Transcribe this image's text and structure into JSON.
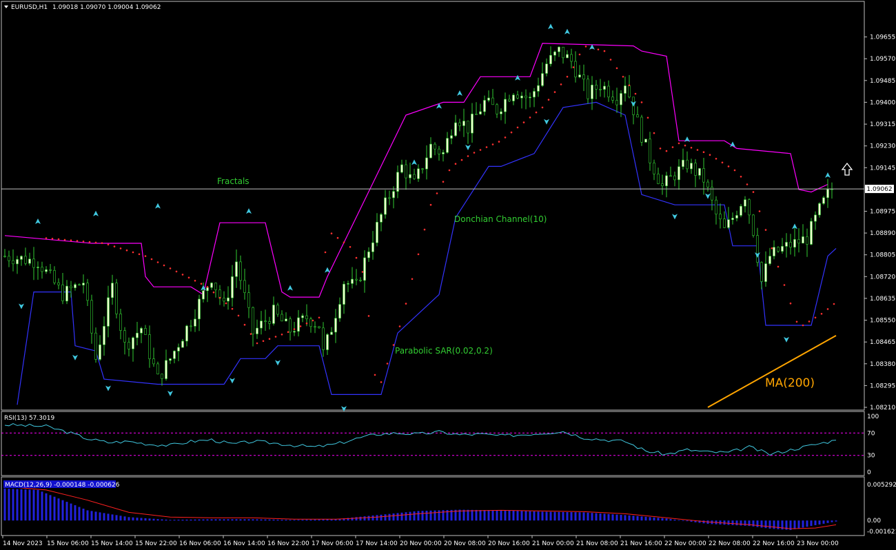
{
  "header": {
    "symbol": "EURUSD,H1",
    "ohlc": "1.09018 1.09070 1.09004 1.09062"
  },
  "colors": {
    "background": "#000000",
    "bull_candle": "#f0ffd0",
    "bear_candle": "#000000",
    "candle_wick": "#32cd32",
    "donchian_upper": "#ff00ff",
    "donchian_lower": "#3333ff",
    "sar": "#ff3030",
    "fractal": "#40c8e0",
    "ma200": "#ffa500",
    "rsi_line": "#40c8e0",
    "rsi_levels": "#ff00ff",
    "macd_hist": "#2222dd",
    "macd_signal": "#ff2020",
    "price_line": "#c0c0c0",
    "label_green": "#32cd32",
    "label_orange": "#ffa500",
    "axis_text": "#ffffff"
  },
  "annotations": {
    "fractals": "Fractals",
    "donchian": "Donchian Channel(10)",
    "sar": "Parabolic SAR(0.02,0.2)",
    "ma": "MA(200)"
  },
  "arrow_icon": "up-arrow-icon",
  "chart_data": {
    "type": "candlestick",
    "main": {
      "ylim": [
        1.0821,
        1.0974
      ],
      "yticks": [
        "1.09655",
        "1.09570",
        "1.09485",
        "1.09400",
        "1.09315",
        "1.09230",
        "1.09145",
        "1.09062",
        "1.08975",
        "1.08890",
        "1.08805",
        "1.08720",
        "1.08635",
        "1.08550",
        "1.08465",
        "1.08380",
        "1.08295",
        "1.08210"
      ],
      "current_price": "1.09062",
      "waypoints": [
        [
          0,
          1.088
        ],
        [
          8,
          1.0878
        ],
        [
          14,
          1.0865
        ],
        [
          19,
          1.087
        ],
        [
          22,
          1.084
        ],
        [
          26,
          1.0868
        ],
        [
          29,
          1.0845
        ],
        [
          33,
          1.0852
        ],
        [
          37,
          1.0832
        ],
        [
          40,
          1.084
        ],
        [
          45,
          1.0855
        ],
        [
          50,
          1.0872
        ],
        [
          53,
          1.086
        ],
        [
          56,
          1.0878
        ],
        [
          60,
          1.085
        ],
        [
          65,
          1.0858
        ],
        [
          69,
          1.0851
        ],
        [
          73,
          1.0856
        ],
        [
          76,
          1.0853
        ],
        [
          77,
          1.0842
        ],
        [
          79,
          1.0852
        ],
        [
          82,
          1.087
        ],
        [
          85,
          1.0868
        ],
        [
          88,
          1.0883
        ],
        [
          92,
          1.09
        ],
        [
          96,
          1.0915
        ],
        [
          99,
          1.0908
        ],
        [
          103,
          1.0923
        ],
        [
          106,
          1.092
        ],
        [
          109,
          1.0935
        ],
        [
          112,
          1.093
        ],
        [
          116,
          1.094
        ],
        [
          119,
          1.0937
        ],
        [
          123,
          1.0945
        ],
        [
          127,
          1.0941
        ],
        [
          131,
          1.0955
        ],
        [
          134,
          1.096
        ],
        [
          137,
          1.0956
        ],
        [
          141,
          1.0943
        ],
        [
          144,
          1.0947
        ],
        [
          148,
          1.0942
        ],
        [
          150,
          1.0948
        ],
        [
          153,
          1.0932
        ],
        [
          156,
          1.0918
        ],
        [
          159,
          1.0907
        ],
        [
          162,
          1.0912
        ],
        [
          165,
          1.0916
        ],
        [
          169,
          1.091
        ],
        [
          172,
          1.0896
        ],
        [
          174,
          1.089
        ],
        [
          176,
          1.0895
        ],
        [
          179,
          1.0904
        ],
        [
          181,
          1.089
        ],
        [
          183,
          1.087
        ],
        [
          185,
          1.088
        ],
        [
          188,
          1.0883
        ],
        [
          191,
          1.0885
        ],
        [
          194,
          1.0887
        ],
        [
          197,
          1.0898
        ],
        [
          199,
          1.0904
        ],
        [
          200,
          1.0906
        ]
      ],
      "donchian_upper": [
        [
          0,
          1.0888
        ],
        [
          21,
          1.0885
        ],
        [
          33,
          1.0885
        ],
        [
          34,
          1.0872
        ],
        [
          36,
          1.0868
        ],
        [
          45,
          1.0868
        ],
        [
          48,
          1.0865
        ],
        [
          52,
          1.0893
        ],
        [
          63,
          1.0893
        ],
        [
          67,
          1.0866
        ],
        [
          69,
          1.0864
        ],
        [
          76,
          1.0864
        ],
        [
          78,
          1.0872
        ],
        [
          97,
          1.0935
        ],
        [
          106,
          1.094
        ],
        [
          111,
          1.094
        ],
        [
          115,
          1.095
        ],
        [
          127,
          1.095
        ],
        [
          130,
          1.0963
        ],
        [
          152,
          1.0962
        ],
        [
          154,
          1.096
        ],
        [
          160,
          1.0958
        ],
        [
          163,
          1.0925
        ],
        [
          174,
          1.0925
        ],
        [
          177,
          1.0922
        ],
        [
          190,
          1.092
        ],
        [
          192,
          1.0906
        ],
        [
          195,
          1.0905
        ],
        [
          199,
          1.0908
        ]
      ],
      "donchian_lower": [
        [
          3,
          1.0822
        ],
        [
          7,
          1.0866
        ],
        [
          16,
          1.0866
        ],
        [
          17,
          1.0845
        ],
        [
          22,
          1.0843
        ],
        [
          24,
          1.0832
        ],
        [
          37,
          1.083
        ],
        [
          53,
          1.083
        ],
        [
          57,
          1.084
        ],
        [
          63,
          1.084
        ],
        [
          66,
          1.0845
        ],
        [
          76,
          1.0845
        ],
        [
          79,
          1.0826
        ],
        [
          91,
          1.0826
        ],
        [
          95,
          1.085
        ],
        [
          105,
          1.0865
        ],
        [
          109,
          1.0895
        ],
        [
          117,
          1.0915
        ],
        [
          120,
          1.0915
        ],
        [
          128,
          1.092
        ],
        [
          135,
          1.0938
        ],
        [
          143,
          1.094
        ],
        [
          150,
          1.0935
        ],
        [
          154,
          1.0904
        ],
        [
          162,
          1.09
        ],
        [
          174,
          1.09
        ],
        [
          176,
          1.0884
        ],
        [
          182,
          1.0884
        ],
        [
          184,
          1.0853
        ],
        [
          195,
          1.0853
        ],
        [
          199,
          1.088
        ],
        [
          201,
          1.0883
        ]
      ],
      "sar": [
        [
          10,
          1.0887
        ],
        [
          24,
          1.0885
        ],
        [
          34,
          1.088
        ],
        [
          49,
          1.0868
        ],
        [
          56,
          1.0858
        ],
        [
          61,
          1.0846
        ],
        [
          68,
          1.085
        ],
        [
          76,
          1.0856
        ],
        [
          78,
          1.089
        ],
        [
          84,
          1.0883
        ],
        [
          87,
          1.0872
        ],
        [
          90,
          1.0826
        ],
        [
          96,
          1.0855
        ],
        [
          103,
          1.09
        ],
        [
          108,
          1.0915
        ],
        [
          113,
          1.092
        ],
        [
          120,
          1.0925
        ],
        [
          130,
          1.0938
        ],
        [
          137,
          1.0952
        ],
        [
          140,
          1.0962
        ],
        [
          145,
          1.096
        ],
        [
          154,
          1.094
        ],
        [
          159,
          1.092
        ],
        [
          163,
          1.0924
        ],
        [
          170,
          1.092
        ],
        [
          177,
          1.0913
        ],
        [
          181,
          1.0905
        ],
        [
          183,
          1.0895
        ],
        [
          192,
          1.0852
        ],
        [
          198,
          1.0858
        ],
        [
          201,
          1.0862
        ]
      ],
      "fractals_up": [
        [
          8,
          1.0892
        ],
        [
          22,
          1.0895
        ],
        [
          37,
          1.0898
        ],
        [
          48,
          1.0866
        ],
        [
          59,
          1.0896
        ],
        [
          69,
          1.0866
        ],
        [
          78,
          1.0873
        ],
        [
          99,
          1.0915
        ],
        [
          105,
          1.0937
        ],
        [
          110,
          1.0942
        ],
        [
          124,
          1.0948
        ],
        [
          132,
          1.0968
        ],
        [
          136,
          1.0966
        ],
        [
          142,
          1.096
        ],
        [
          165,
          1.0924
        ],
        [
          176,
          1.0922
        ],
        [
          191,
          1.089
        ],
        [
          199,
          1.091
        ]
      ],
      "fractals_down": [
        [
          4,
          1.0862
        ],
        [
          17,
          1.0842
        ],
        [
          25,
          1.083
        ],
        [
          40,
          1.0828
        ],
        [
          55,
          1.0833
        ],
        [
          66,
          1.084
        ],
        [
          82,
          1.0822
        ],
        [
          112,
          1.0924
        ],
        [
          131,
          1.0934
        ],
        [
          152,
          1.0941
        ],
        [
          162,
          1.0897
        ],
        [
          170,
          1.0905
        ],
        [
          182,
          1.0882
        ],
        [
          189,
          1.0849
        ]
      ],
      "ma200": [
        [
          170,
          1.0821
        ],
        [
          201,
          1.0849
        ]
      ]
    },
    "rsi": {
      "label": "RSI(13) 57.3019",
      "levels": [
        30,
        70
      ],
      "yticks": [
        "100",
        "70",
        "30",
        "0"
      ],
      "waypoints": [
        [
          0,
          85
        ],
        [
          10,
          82
        ],
        [
          15,
          72
        ],
        [
          20,
          60
        ],
        [
          25,
          53
        ],
        [
          30,
          55
        ],
        [
          35,
          50
        ],
        [
          40,
          48
        ],
        [
          45,
          55
        ],
        [
          50,
          58
        ],
        [
          55,
          50
        ],
        [
          60,
          55
        ],
        [
          65,
          52
        ],
        [
          70,
          48
        ],
        [
          75,
          45
        ],
        [
          80,
          50
        ],
        [
          85,
          60
        ],
        [
          90,
          68
        ],
        [
          95,
          70
        ],
        [
          100,
          68
        ],
        [
          105,
          72
        ],
        [
          110,
          67
        ],
        [
          115,
          68
        ],
        [
          120,
          65
        ],
        [
          125,
          67
        ],
        [
          130,
          70
        ],
        [
          135,
          73
        ],
        [
          140,
          62
        ],
        [
          145,
          58
        ],
        [
          150,
          55
        ],
        [
          155,
          38
        ],
        [
          160,
          32
        ],
        [
          165,
          40
        ],
        [
          170,
          36
        ],
        [
          175,
          35
        ],
        [
          180,
          45
        ],
        [
          185,
          32
        ],
        [
          190,
          40
        ],
        [
          195,
          48
        ],
        [
          201,
          57.3
        ]
      ]
    },
    "macd": {
      "label": "MACD(12,26,9) -0.000148 -0.000626",
      "yticks": [
        "0.005292",
        "0.00",
        "-0.001621"
      ],
      "ylim": [
        -0.0017,
        0.0055
      ],
      "hist_waypoints": [
        [
          0,
          0.0047
        ],
        [
          8,
          0.0045
        ],
        [
          14,
          0.003
        ],
        [
          20,
          0.0015
        ],
        [
          30,
          0.0005
        ],
        [
          40,
          0.0001
        ],
        [
          50,
          0.0002
        ],
        [
          60,
          0.0002
        ],
        [
          70,
          0.0001
        ],
        [
          80,
          0.0002
        ],
        [
          90,
          0.0008
        ],
        [
          100,
          0.0014
        ],
        [
          110,
          0.0016
        ],
        [
          120,
          0.0015
        ],
        [
          130,
          0.0013
        ],
        [
          140,
          0.0012
        ],
        [
          150,
          0.0008
        ],
        [
          160,
          0.0003
        ],
        [
          170,
          -0.0005
        ],
        [
          180,
          -0.0008
        ],
        [
          185,
          -0.0012
        ],
        [
          190,
          -0.0014
        ],
        [
          195,
          -0.0008
        ],
        [
          201,
          -0.00015
        ]
      ],
      "signal_waypoints": [
        [
          0,
          0.005
        ],
        [
          10,
          0.0045
        ],
        [
          20,
          0.003
        ],
        [
          30,
          0.0012
        ],
        [
          40,
          0.0005
        ],
        [
          50,
          0.0004
        ],
        [
          60,
          0.0004
        ],
        [
          70,
          0.0002
        ],
        [
          80,
          0.0002
        ],
        [
          90,
          0.0005
        ],
        [
          100,
          0.001
        ],
        [
          110,
          0.0014
        ],
        [
          120,
          0.0015
        ],
        [
          130,
          0.0014
        ],
        [
          140,
          0.0013
        ],
        [
          150,
          0.001
        ],
        [
          160,
          0.0004
        ],
        [
          170,
          -0.0002
        ],
        [
          180,
          -0.0006
        ],
        [
          190,
          -0.0012
        ],
        [
          196,
          -0.0011
        ],
        [
          201,
          -0.00063
        ]
      ]
    },
    "x_tick_labels": [
      "14 Nov 2023",
      "15 Nov 06:00",
      "15 Nov 14:00",
      "15 Nov 22:00",
      "16 Nov 06:00",
      "16 Nov 14:00",
      "16 Nov 22:00",
      "17 Nov 06:00",
      "17 Nov 14:00",
      "20 Nov 00:00",
      "20 Nov 08:00",
      "20 Nov 16:00",
      "21 Nov 00:00",
      "21 Nov 08:00",
      "21 Nov 16:00",
      "22 Nov 00:00",
      "22 Nov 08:00",
      "22 Nov 16:00",
      "23 Nov 00:00"
    ]
  }
}
